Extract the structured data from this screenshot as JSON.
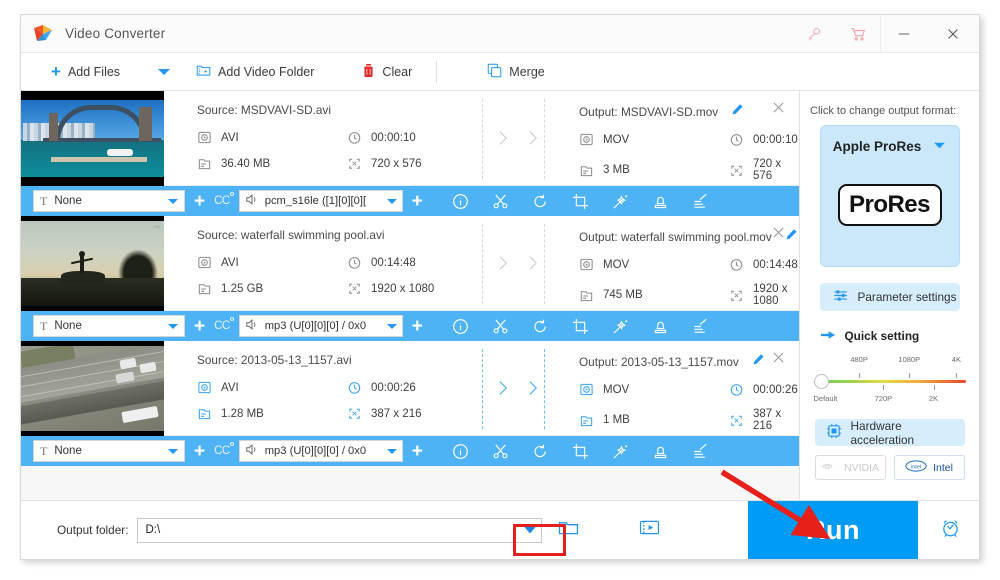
{
  "window": {
    "title": "Video Converter",
    "logo_icon": "video-converter-logo-icon",
    "key_icon": "key-icon",
    "cart_icon": "shopping-cart-icon",
    "minimize_label": "–",
    "close_label": "✕"
  },
  "toolbar": {
    "add_files": "Add Files",
    "add_files_icon": "plus-icon",
    "dropdown_icon": "chevron-down-icon",
    "add_folder": "Add Video Folder",
    "add_folder_icon": "folder-video-icon",
    "clear": "Clear",
    "clear_icon": "trash-icon",
    "merge": "Merge",
    "merge_icon": "merge-squares-icon"
  },
  "items": [
    {
      "thumb": "harbour-bridge-thumbnail",
      "source_title": "Source: MSDVAVI-SD.avi",
      "source_format": "AVI",
      "source_duration": "00:00:10",
      "source_size": "36.40 MB",
      "source_resolution": "720 x 576",
      "output_title": "Output: MSDVAVI-SD.mov",
      "output_format": "MOV",
      "output_duration": "00:00:10",
      "output_size": "3 MB",
      "output_resolution": "720 x 576",
      "subtitle": "None",
      "audio": "pcm_s16le ([1][0][0][",
      "selected": false
    },
    {
      "thumb": "sunset-silhouette-thumbnail",
      "source_title": "Source: waterfall swimming pool.avi",
      "source_format": "AVI",
      "source_duration": "00:14:48",
      "source_size": "1.25 GB",
      "source_resolution": "1920 x 1080",
      "output_title": "Output: waterfall swimming pool.mov",
      "output_format": "MOV",
      "output_duration": "00:14:48",
      "output_size": "745 MB",
      "output_resolution": "1920 x 1080",
      "subtitle": "None",
      "audio": "mp3 (U[0][0][0] / 0x0",
      "selected": false
    },
    {
      "thumb": "aerial-road-thumbnail",
      "source_title": "Source: 2013-05-13_1157.avi",
      "source_format": "AVI",
      "source_duration": "00:00:26",
      "source_size": "1.28 MB",
      "source_resolution": "387 x 216",
      "output_title": "Output: 2013-05-13_1157.mov",
      "output_format": "MOV",
      "output_duration": "00:00:26",
      "output_size": "1 MB",
      "output_resolution": "387 x 216",
      "subtitle": "None",
      "audio": "mp3 (U[0][0][0] / 0x0",
      "selected": true
    }
  ],
  "strip_icons": [
    "info-icon",
    "cut-scissors-icon",
    "rotate-icon",
    "crop-icon",
    "effects-wand-icon",
    "watermark-stamp-icon",
    "subtitle-edit-icon"
  ],
  "sidebar": {
    "hint": "Click to change output format:",
    "format_name": "Apple ProRes",
    "format_badge": "ProRes",
    "format_caret_icon": "chevron-down-icon",
    "parameter_settings": "Parameter settings",
    "parameter_icon": "sliders-icon",
    "quick_setting": "Quick setting",
    "quick_setting_icon": "quick-setting-icon",
    "slider": {
      "top_labels": [
        "480P",
        "1080P",
        "4K"
      ],
      "bottom_labels": [
        "Default",
        "720P",
        "2K"
      ],
      "value": "Default"
    },
    "hardware_acceleration": "Hardware acceleration",
    "hardware_icon": "chip-icon",
    "gpus": [
      {
        "label": "NVIDIA",
        "icon": "nvidia-icon",
        "enabled": false
      },
      {
        "label": "Intel",
        "icon": "intel-icon",
        "enabled": true
      }
    ]
  },
  "footer": {
    "output_folder_label": "Output folder:",
    "output_folder_value": "D:\\",
    "dropdown_icon": "chevron-down-icon",
    "folder_icon": "open-folder-icon",
    "film_icon": "media-library-icon",
    "run_label": "Run",
    "alarm_icon": "alarm-clock-icon"
  },
  "annotations": {
    "highlight_box_color": "#e41f1f",
    "arrow_color": "#e8201a",
    "accent_blue": "#2196f3",
    "strip_blue": "#4db3f5",
    "run_blue": "#009bf5"
  }
}
